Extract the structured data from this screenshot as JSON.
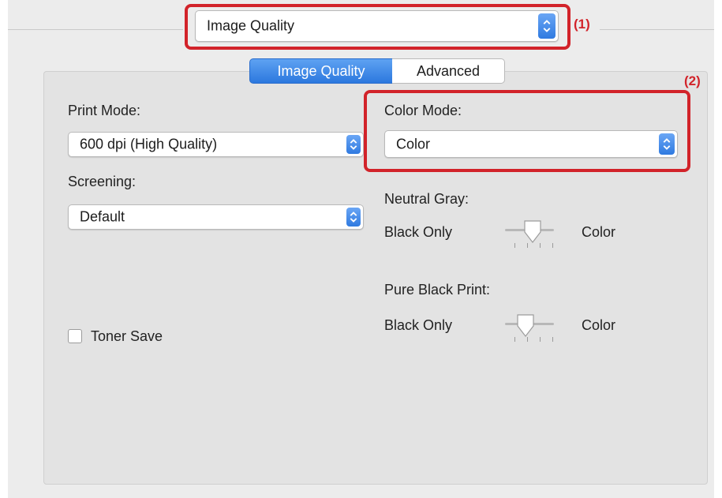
{
  "preset_menu": {
    "value": "Image Quality"
  },
  "callouts": {
    "one": "(1)",
    "two": "(2)"
  },
  "tabs": [
    {
      "label": "Image Quality",
      "selected": true
    },
    {
      "label": "Advanced",
      "selected": false
    }
  ],
  "print_mode": {
    "label": "Print Mode:",
    "value": "600 dpi (High Quality)"
  },
  "screening": {
    "label": "Screening:",
    "value": "Default"
  },
  "color_mode": {
    "label": "Color Mode:",
    "value": "Color"
  },
  "neutral_gray": {
    "label": "Neutral Gray:",
    "min_label": "Black Only",
    "max_label": "Color",
    "position": 0.5
  },
  "pure_black_print": {
    "label": "Pure Black Print:",
    "min_label": "Black Only",
    "max_label": "Color",
    "position": 0.25
  },
  "toner_save": {
    "label": "Toner Save",
    "checked": false
  },
  "colors": {
    "accent": "#2f7ae0",
    "highlight": "#d2232a"
  }
}
